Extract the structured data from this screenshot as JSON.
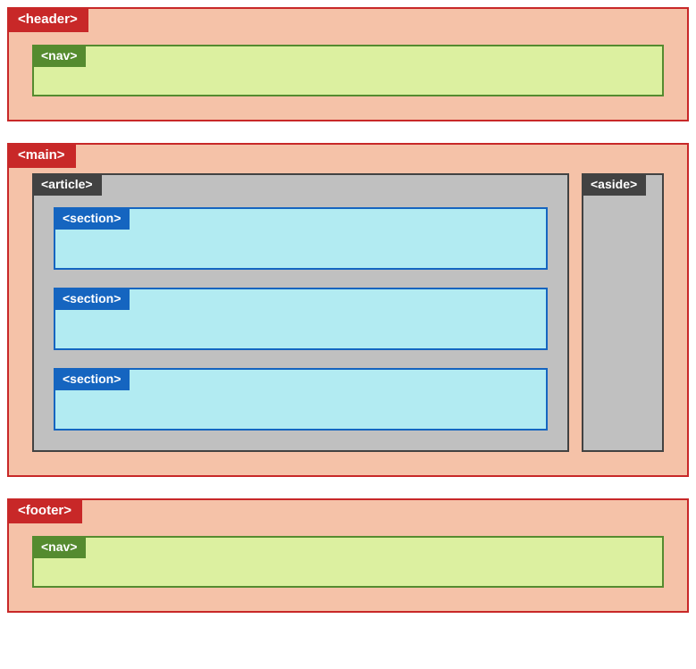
{
  "header": {
    "tag": "<header>",
    "nav": {
      "tag": "<nav>"
    }
  },
  "main": {
    "tag": "<main>",
    "article": {
      "tag": "<article>",
      "sections": [
        {
          "tag": "<section>"
        },
        {
          "tag": "<section>"
        },
        {
          "tag": "<section>"
        }
      ]
    },
    "aside": {
      "tag": "<aside>"
    }
  },
  "footer": {
    "tag": "<footer>",
    "nav": {
      "tag": "<nav>"
    }
  }
}
